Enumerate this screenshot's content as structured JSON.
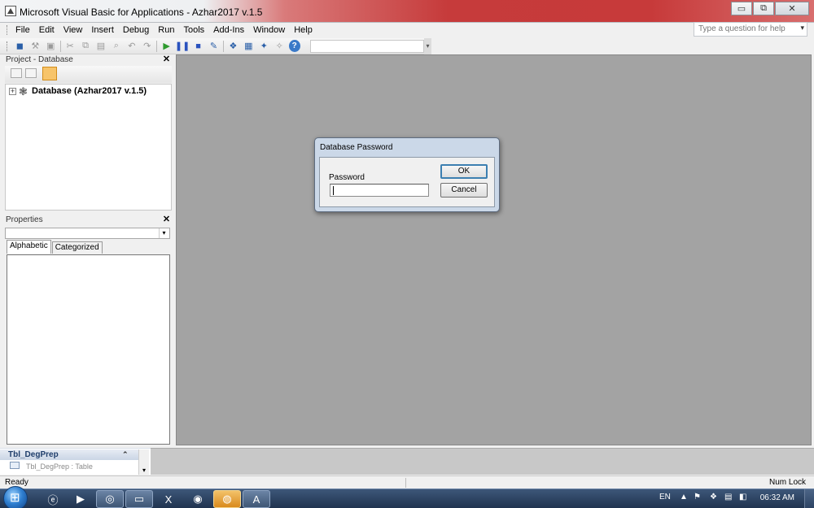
{
  "window": {
    "title": "Microsoft Visual Basic for Applications - Azhar2017 v.1.5",
    "controls": {
      "minimize": "▭",
      "restore": "⧉",
      "close": "✕"
    }
  },
  "menu": {
    "items": [
      "File",
      "Edit",
      "View",
      "Insert",
      "Debug",
      "Run",
      "Tools",
      "Add-Ins",
      "Window",
      "Help"
    ],
    "help_placeholder": "Type a question for help"
  },
  "toolbar": {
    "icons": [
      "access-icon",
      "insert-userform-icon",
      "save-icon",
      "cut-icon",
      "copy-icon",
      "paste-icon",
      "find-icon",
      "undo-icon",
      "redo-icon",
      "run-icon",
      "break-icon",
      "reset-icon",
      "design-mode-icon",
      "project-explorer-icon",
      "properties-window-icon",
      "object-browser-icon",
      "toolbox-icon",
      "help-icon"
    ]
  },
  "project_pane": {
    "title": "Project - Database",
    "close": "✕",
    "tree": {
      "expander": "+",
      "label": "Database (Azhar2017 v.1.5)"
    }
  },
  "properties_pane": {
    "title": "Properties",
    "close": "✕",
    "tabs": [
      "Alphabetic",
      "Categorized"
    ]
  },
  "nav_pane": {
    "group": "Tbl_DegPrep",
    "collapse": "⌃",
    "item": "Tbl_DegPrep : Table"
  },
  "status": {
    "left": "Ready",
    "right": "Num Lock"
  },
  "dialog": {
    "title": "Database Password",
    "label": "Password",
    "value": "",
    "ok": "OK",
    "cancel": "Cancel"
  },
  "taskbar": {
    "language": "EN",
    "time": "06:32 AM",
    "apps": [
      "ie-icon",
      "media-player-icon",
      "snipping-icon",
      "explorer-icon",
      "excel-icon",
      "chrome-icon",
      "firefox-icon",
      "access-icon"
    ]
  },
  "colors": {
    "workspace": "#a3a3a3",
    "dialog_frame": "#cbd8e8",
    "default_button": "#3c7fb1"
  }
}
